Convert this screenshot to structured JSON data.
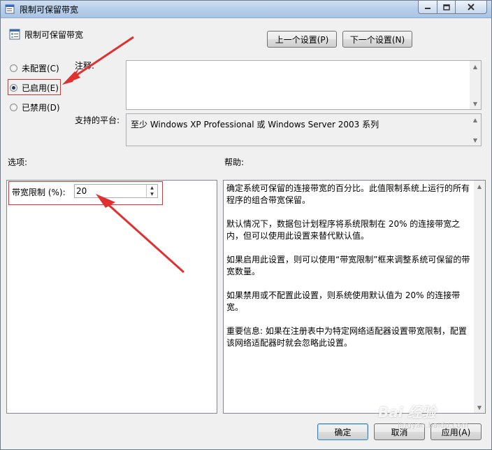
{
  "window": {
    "title": "限制可保留带宽"
  },
  "header": {
    "policy_name": "限制可保留带宽",
    "prev_button": "上一个设置(P)",
    "next_button": "下一个设置(N)"
  },
  "state": {
    "options": [
      {
        "label": "未配置(C)",
        "checked": false
      },
      {
        "label": "已启用(E)",
        "checked": true
      },
      {
        "label": "已禁用(D)",
        "checked": false
      }
    ]
  },
  "comment": {
    "label": "注释:",
    "value": ""
  },
  "platform": {
    "label": "支持的平台:",
    "value": "至少 Windows XP Professional 或 Windows Server 2003 系列"
  },
  "options_panel": {
    "label": "选项:",
    "bandwidth_label": "带宽限制 (%):",
    "bandwidth_value": "20"
  },
  "help_panel": {
    "label": "帮助:",
    "paragraphs": [
      "确定系统可保留的连接带宽的百分比。此值限制系统上运行的所有程序的组合带宽保留。",
      "默认情况下，数据包计划程序将系统限制在 20% 的连接带宽之内，但可以使用此设置来替代默认值。",
      "如果启用此设置，则可以使用“带宽限制”框来调整系统可保留的带宽数量。",
      "如果禁用或不配置此设置，则系统使用默认值为 20% 的连接带宽。",
      "重要信息: 如果在注册表中为特定网络适配器设置带宽限制，配置该网络适配器时就会忽略此设置。"
    ]
  },
  "footer": {
    "ok_button": "确定",
    "cancel_button": "取消",
    "apply_button": "应用(A)"
  },
  "watermark": {
    "text": "Bai 经验",
    "sub": "jingyan.baidu.com"
  },
  "colors": {
    "annotation": "#e03030",
    "titlebar": "#b9d0ea"
  }
}
